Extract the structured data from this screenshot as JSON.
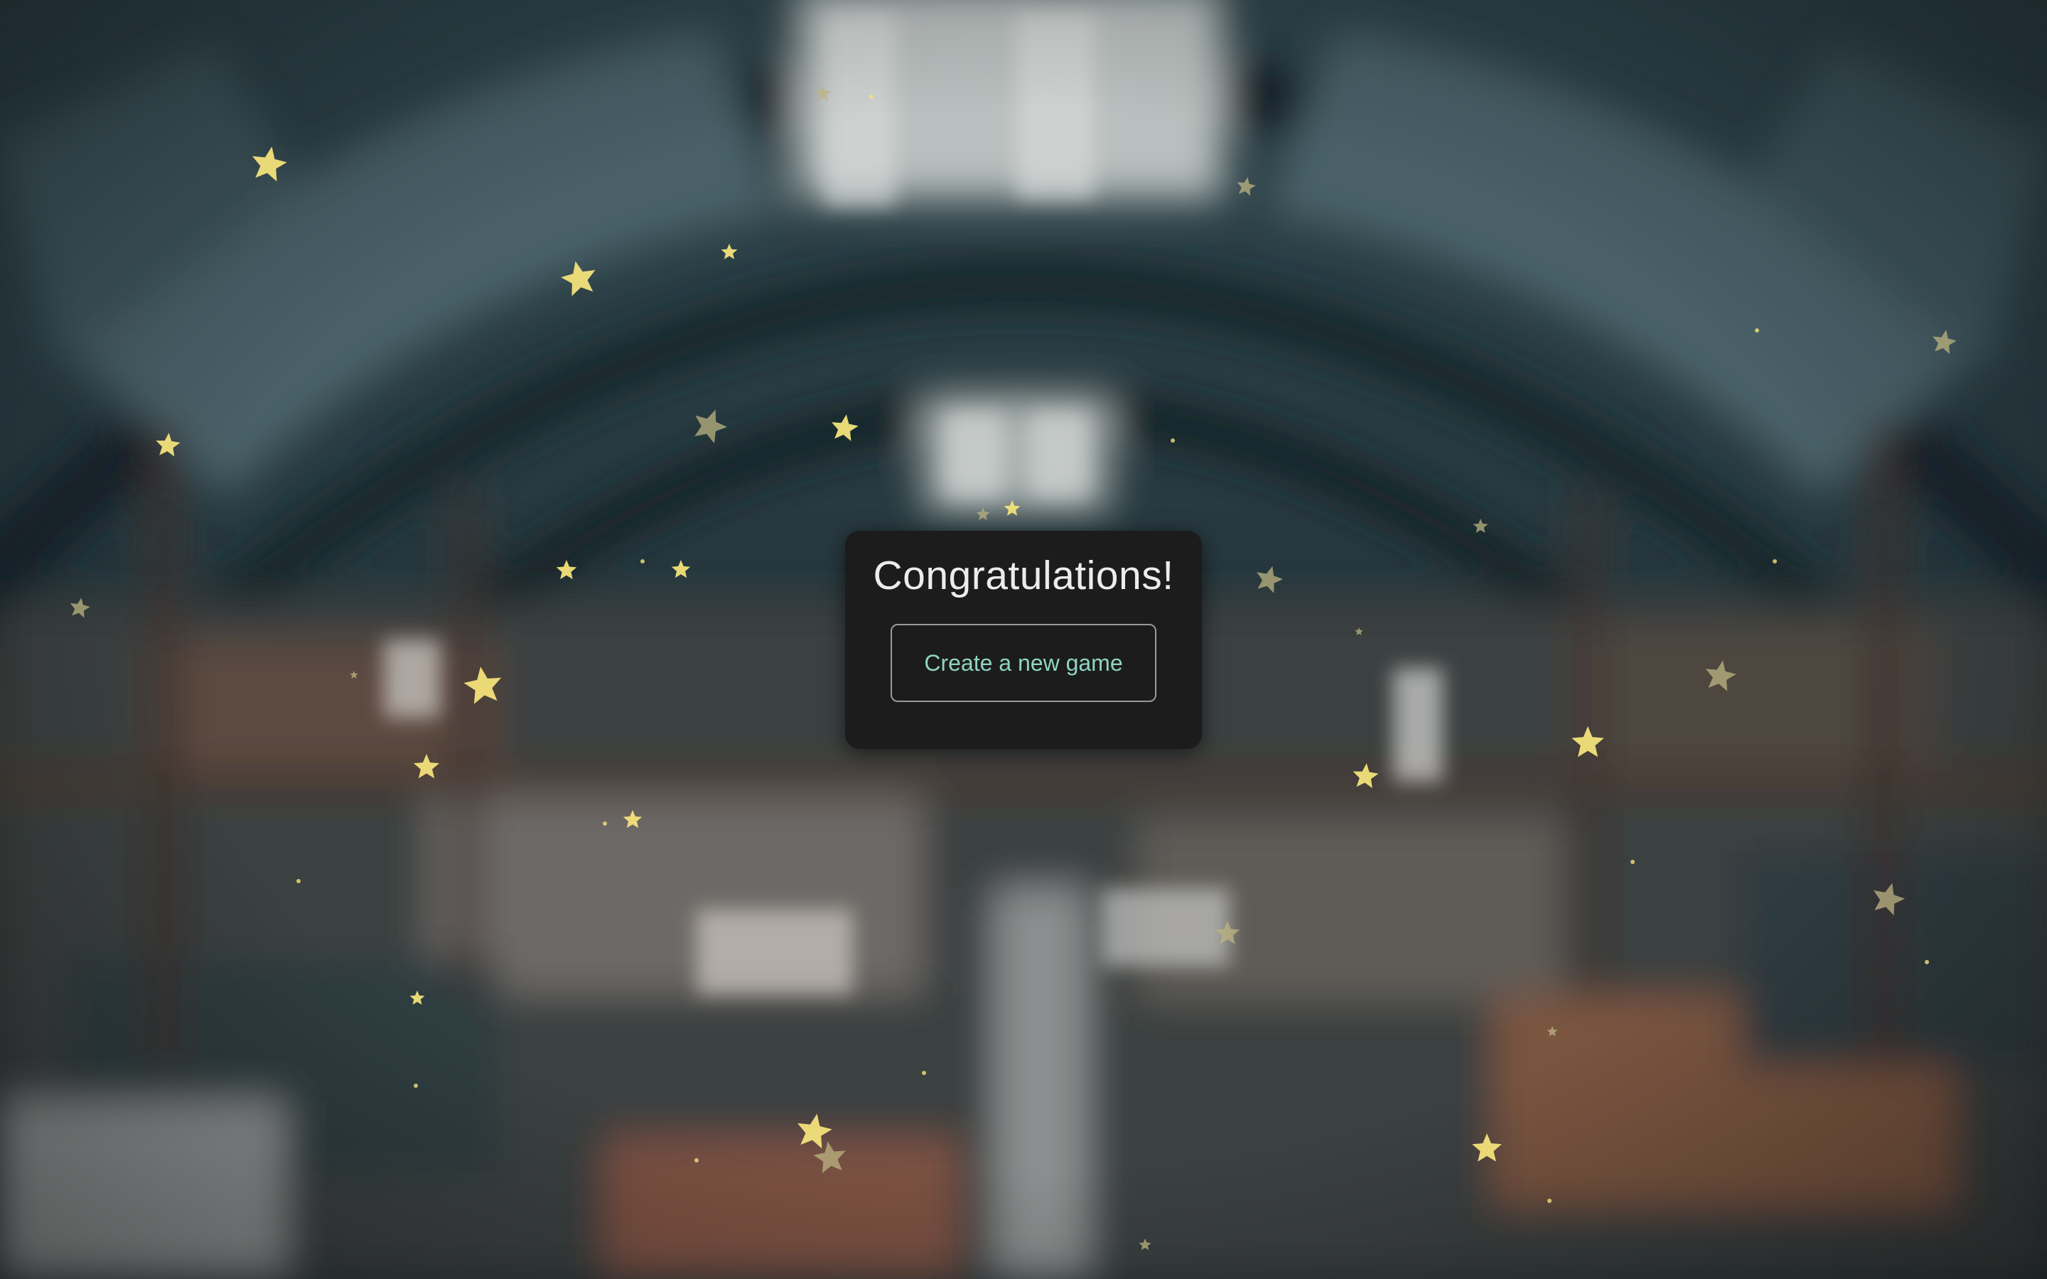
{
  "scene": {
    "background_description_icon": "blurred-market-hall-background",
    "star_color": "#f3e27a",
    "star_dim_color": "#bcb482"
  },
  "dialog": {
    "title": "Congratulations!",
    "new_game_button_label": "Create a new game",
    "title_color": "#ececec",
    "button_text_color": "#8fd5c2"
  },
  "confetti": {
    "icon": "star-icon",
    "count": 42
  }
}
